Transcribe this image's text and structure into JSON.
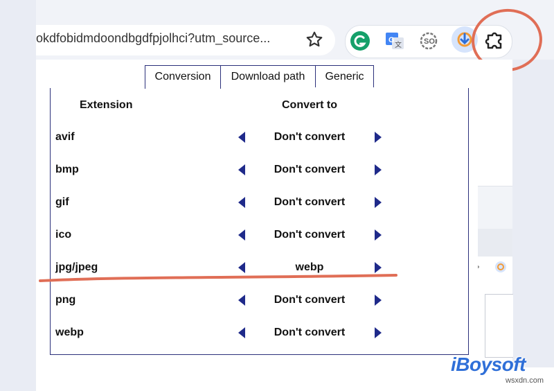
{
  "browser": {
    "url_text": "okdfobidmdoondbgdfpjolhci?utm_source..."
  },
  "icons": {
    "star": "star-icon",
    "extensions": [
      "grammarly-icon",
      "translate-icon",
      "speed-icon",
      "download-extension-icon",
      "puzzle-icon"
    ],
    "folder": "folder-icon"
  },
  "tabs": [
    {
      "label": "Conversion",
      "active": true
    },
    {
      "label": "Download path",
      "active": false
    },
    {
      "label": "Generic",
      "active": false
    }
  ],
  "table": {
    "headers": {
      "extension": "Extension",
      "convert_to": "Convert to"
    },
    "rows": [
      {
        "extension": "avif",
        "convert_to": "Don't convert"
      },
      {
        "extension": "bmp",
        "convert_to": "Don't convert"
      },
      {
        "extension": "gif",
        "convert_to": "Don't convert"
      },
      {
        "extension": "ico",
        "convert_to": "Don't convert"
      },
      {
        "extension": "jpg/jpeg",
        "convert_to": "webp"
      },
      {
        "extension": "png",
        "convert_to": "Don't convert"
      },
      {
        "extension": "webp",
        "convert_to": "Don't convert"
      }
    ]
  },
  "annotations": {
    "highlight_color": "#e06e56"
  },
  "watermark": {
    "brand": "iBoysoft",
    "site": "wsxdn.com"
  },
  "colors": {
    "accent": "#2a2f7a",
    "arrow": "#1f2a8a",
    "brand": "#2f6fd8"
  }
}
